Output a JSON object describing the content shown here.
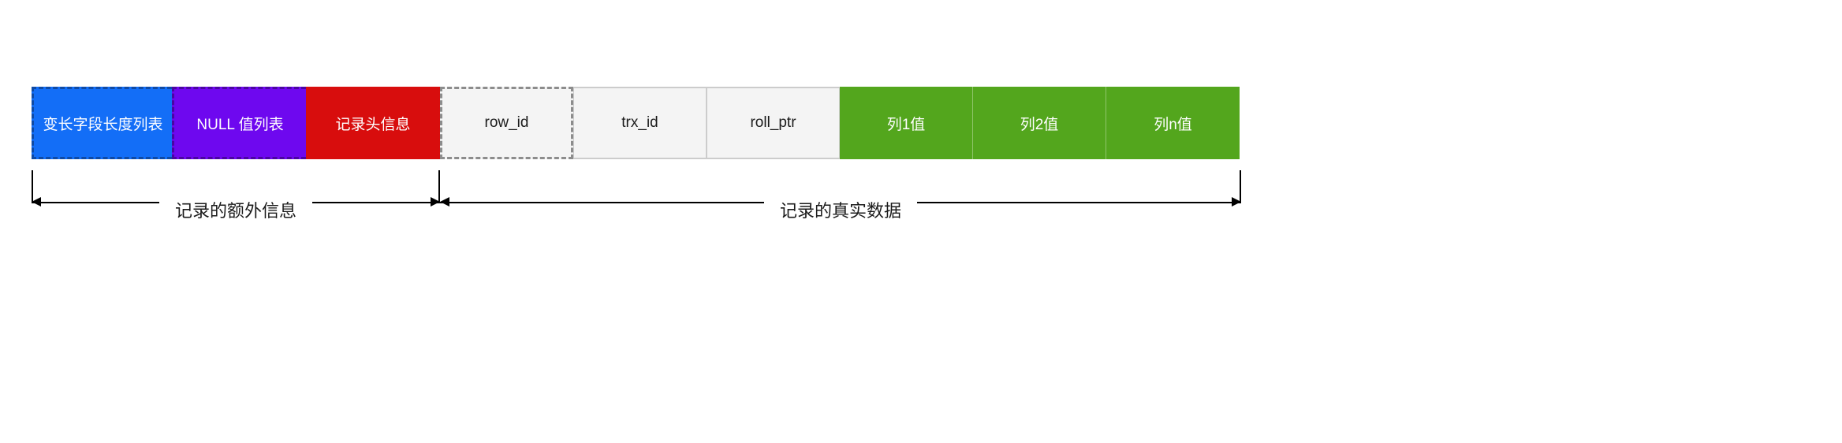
{
  "cells": {
    "varLenList": "变长字段长度列表",
    "nullList": "NULL 值列表",
    "recordHeader": "记录头信息",
    "rowId": "row_id",
    "trxId": "trx_id",
    "rollPtr": "roll_ptr",
    "col1": "列1值",
    "col2": "列2值",
    "colN": "列n值"
  },
  "brackets": {
    "extraInfo": "记录的额外信息",
    "realData": "记录的真实数据"
  }
}
